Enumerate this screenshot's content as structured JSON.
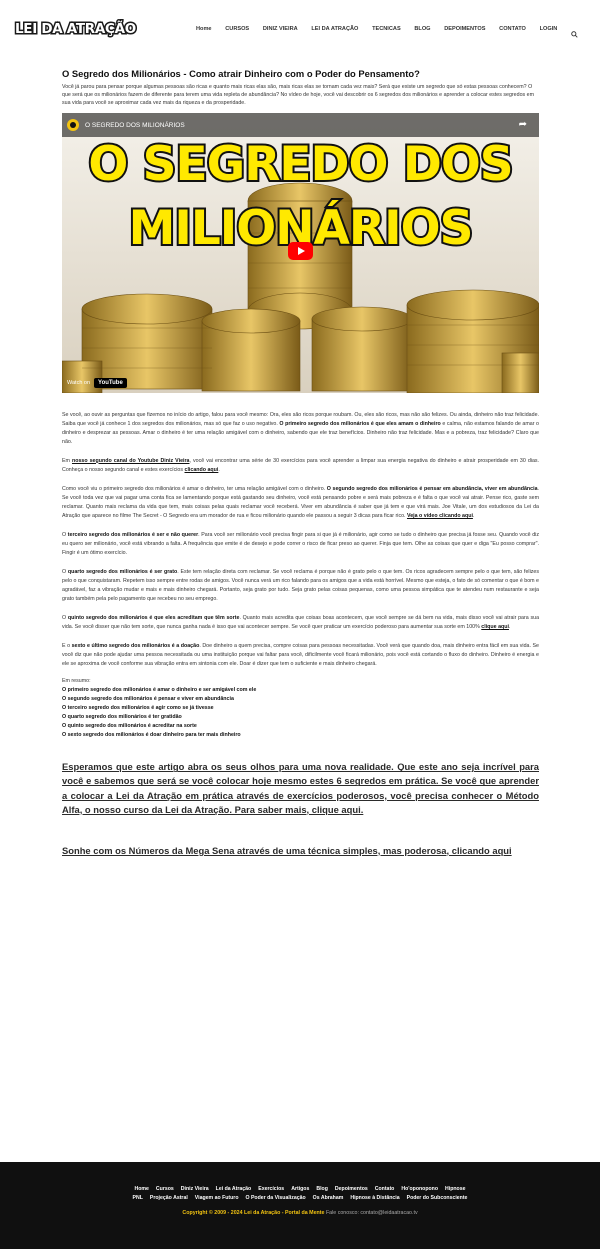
{
  "header": {
    "logo": "LEI DA ATRAÇÃO",
    "nav": [
      "Home",
      "CURSOS",
      "DINIZ VIEIRA",
      "LEI DA ATRAÇÃO",
      "TECNICAS",
      "BLOG",
      "DEPOIMENTOS",
      "CONTATO",
      "LOGIN"
    ],
    "search_icon": "search-icon"
  },
  "article": {
    "title": "O Segredo dos Milionários - Como atrair Dinheiro com o Poder do Pensamento?",
    "intro": "Você já parou para pensar porque algumas pessoas são ricas e quanto mais ricas elas são, mais ricas elas se tornam cada vez mais? Será que existe um segredo que só estas pessoas conhecem? O que será que os milionários fazem de diferente para terem uma vida repleta de abundância? No vídeo de hoje, você vai descobrir os 6 segredos dos milionários e aprender a colocar estes segredos em sua vida para você se aproximar cada vez mais da riqueza e da prosperidade.",
    "video": {
      "title": "O SEGREDO DOS MILIONÁRIOS",
      "big_line1": "O SEGREDO DOS",
      "big_line2": "MILIONÁRIOS",
      "watch_on": "Watch on",
      "youtube": "YouTube"
    },
    "p1_a": "Se você, ao ouvir as perguntas que fizemos no início do artigo, falou para você mesmo: Ora, eles são ricos porque roubam. Ou, eles são ricos, mas não são felizes. Ou ainda, dinheiro não traz felicidade. Saiba que você já conhece 1 dos segredos dos milionários, mas só que faz o uso negativo. ",
    "p1_b": "O primeiro segredo dos milionários é que eles amam o dinheiro",
    "p1_c": " e calma, não estamos falando de amar o dinheiro e desprezar as pessoas. Amar o dinheiro é ter uma relação amigável com o dinheiro, sabendo que ele traz benefícios. Dinheiro não traz felicidade. Mas e a pobreza, traz felicidade? Claro que não.",
    "p2_a": "Em ",
    "p2_link": "nosso segundo canal do Youtube Diniz Vieira",
    "p2_b": ", você vai encontrar uma série de 30 exercícios para você aprender a limpar sua energia negativa do dinheiro e atrair prosperidade em 30 dias. Conheça o nosso segundo canal e estes exercícios ",
    "p2_link2": "clicando aqui",
    "p3_a": "Como você viu o primeiro segredo dos milionários é amar o dinheiro, ter uma relação amigável com o dinheiro. ",
    "p3_b": "O segundo segredo dos milionários é pensar em abundância, viver em abundância",
    "p3_c": ". Se você toda vez que vai pagar uma conta fica se lamentando porque está gastando seu dinheiro, você está pensando pobre e será mais pobreza e é falta o que você vai atrair. Pense rico, gaste sem reclamar. Quanto mais reclama da vida que tem, mais coisas pelas quais reclamar você receberá. Viver em abundância é saber que já tem e que virá mais. Joe Vitale, um dos estudiosos da Lei da Atração que aparece no filme The Secret - O Segredo era um morador de rua e ficou milionário quando ele passou a seguir 3 dicas para ficar rico. ",
    "p3_link": "Veja o vídeo clicando aqui",
    "p4_a": "O ",
    "p4_b": "terceiro segredo dos milionários é ser e não querer",
    "p4_c": ". Para você ser milionário você precisa fingir para si que já é milionário, agir como se tudo o dinheiro que precisa já fosse seu. Quando você diz eu quero ser milionário, você está vibrando a falta. A frequência que emite é de desejo e pode correr o risco de ficar preso ao querer. Finja que tem. Olhe as coisas que quer e diga \"Eu posso comprar\". Fingir é um ótimo exercício.",
    "p5_a": "O ",
    "p5_b": "quarto segredo dos milionários é ser grato",
    "p5_c": ". Este tem relação direta com reclamar. Se você reclama é porque não é grato pelo o que tem. Os ricos agradecem sempre pelo o que tem, são felizes pelo o que conquistaram. Repetem isso sempre entre rodas de amigos. Você nunca verá um rico falando para os amigos que a vida está horrível. Mesmo que esteja, o fato de só comentar o que é bom e agradável, faz a vibração mudar e mais e mais dinheiro chegará. Portanto, seja grato por tudo. Seja grato pelas coisas pequenas, como uma pessoa simpática que te atendeu num restaurante e seja grato também pela pelo pagamento que recebeu no seu emprego.",
    "p6_a": "O ",
    "p6_b": "quinto segredo dos milionários é que eles acreditam que têm sorte",
    "p6_c": ". Quanto mais acredita que coisas boas acontecem, que você sempre se dá bem na vida, mais disso você vai atrair para sua vida. Se você disser que não tem sorte, que nunca ganha nada é isso que vai acontecer sempre. Se você quer praticar um exercício poderoso para aumentar sua sorte em 100% ",
    "p6_link": "clique aqui",
    "p7_a": "E o ",
    "p7_b": "sexto e último segredo dos milionários é a doação",
    "p7_c": ". Doe dinheiro a quem precisa, compre coisas para pessoas necessitadas. Você verá que quando doa, mais dinheiro entra fácil em sua vida. Se você diz que não pode ajudar uma pessoa necessitada ou uma instituição porque vai faltar para você, dificilmente você ficará milionário, pois você está cortando o fluxo do dinheiro. Dinheiro é energia e ele se aproxima de você conforme sua vibração entra em sintonia com ele. Doar é dizer que tem o suficiente e mais dinheiro chegará.",
    "summary_title": "Em resumo:",
    "summary": [
      "O primeiro segredo dos milionários é amar o dinheiro e ser amigável com ele",
      "O segundo segredo dos milionários é pensar e viver em abundância",
      "O terceiro segredo dos milionários é agir como se já tivesse",
      "O quarto segredo dos milionários é ter gratidão",
      "O quinto segredo dos milionários é acreditar na sorte",
      "O sexto segredo dos milionários é doar dinheiro para ter mais dinheiro"
    ],
    "cta1": "Esperamos que este artigo abra os seus olhos para uma nova realidade. Que este ano seja incrível para você e sabemos que será se você colocar hoje mesmo estes 6 segredos em prática. Se você que aprender a colocar a Lei da Atração em prática através de exercícios poderosos, você precisa conhecer o Método Alfa, o nosso curso da Lei da Atração. Para saber mais, clique aqui.",
    "cta2": "Sonhe com os Números da Mega Sena através de uma técnica simples, mas poderosa, clicando aqui"
  },
  "footer": {
    "row1": [
      "Home",
      "Cursos",
      "Diniz Vieira",
      "Lei da Atração",
      "Exercícios",
      "Artigos",
      "Blog",
      "Depoimentos",
      "Contato",
      "Ho'oponopono",
      "Hipnose"
    ],
    "row2": [
      "PNL",
      "Projeção Astral",
      "Viagem ao Futuro",
      "O Poder da Visualização",
      "Os Abraham",
      "Hipnose à Distância",
      "Poder do Subconsciente"
    ],
    "copyright": "Copyright © 2009 - 2024 Lei da Atração - Portal da Mente",
    "contact": " Fale conosco: contato@leidaatracao.tv"
  },
  "colors": {
    "accent_yellow": "#f2c311",
    "footer_bg": "#101010",
    "video_title_yellow": "#ffe900",
    "play_red": "#ff0000"
  }
}
